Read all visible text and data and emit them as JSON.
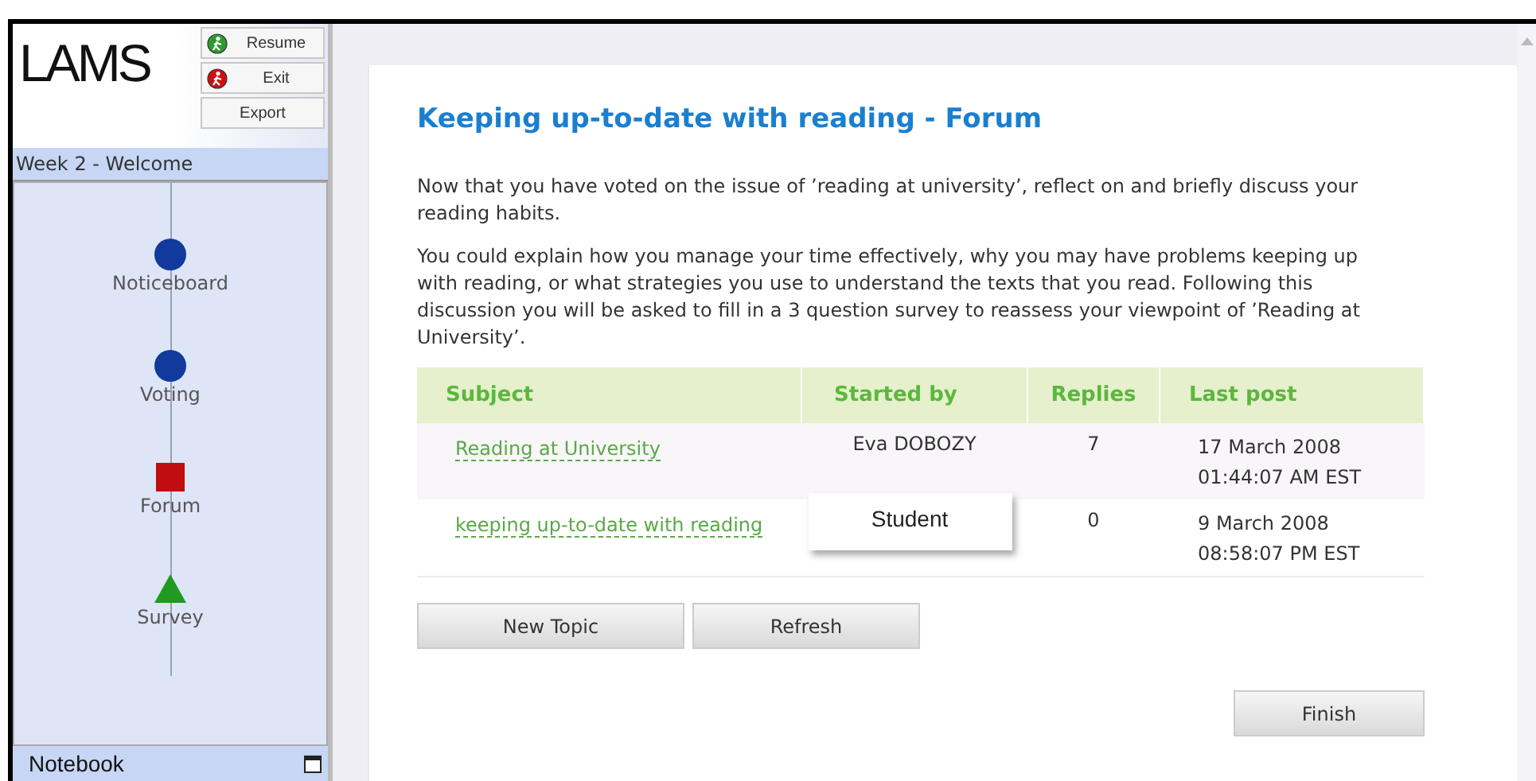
{
  "sidebar": {
    "logo": "LAMS",
    "buttons": [
      {
        "label": "Resume",
        "kind": "go"
      },
      {
        "label": "Exit",
        "kind": "stop"
      },
      {
        "label": "Export",
        "kind": "plain"
      }
    ],
    "lesson_title": "Week 2 - Welcome",
    "activities": [
      {
        "label": "Noticeboard",
        "kind": "completed"
      },
      {
        "label": "Voting",
        "kind": "completed"
      },
      {
        "label": "Forum",
        "kind": "current"
      },
      {
        "label": "Survey",
        "kind": "todo"
      }
    ],
    "notebook": {
      "label": "Notebook"
    }
  },
  "main": {
    "title": "Keeping up-to-date with reading - Forum",
    "paragraphs": [
      "Now that you have voted on the issue of ’reading at university’, reflect on and briefly discuss your reading habits.",
      "You could explain how you manage your time effectively, why you may have problems keeping up with reading, or what strategies you use to understand the texts that you read.  Following this discussion you will be asked to fill in a 3 question survey to reassess your viewpoint of ’Reading at University’."
    ],
    "table": {
      "columns": [
        "Subject",
        "Started by",
        "Replies",
        "Last post"
      ],
      "rows": [
        {
          "subject": "Reading at University",
          "started_by": "Eva DOBOZY",
          "replies": "7",
          "last_post": [
            "17 March 2008",
            "01:44:07 AM EST"
          ]
        },
        {
          "subject": "keeping up-to-date with reading",
          "tooltip": "Student",
          "replies": "0",
          "last_post": [
            "9 March 2008",
            "08:58:07 PM EST"
          ]
        }
      ]
    },
    "buttons": [
      "New Topic",
      "Refresh"
    ],
    "finish_button": "Finish"
  }
}
